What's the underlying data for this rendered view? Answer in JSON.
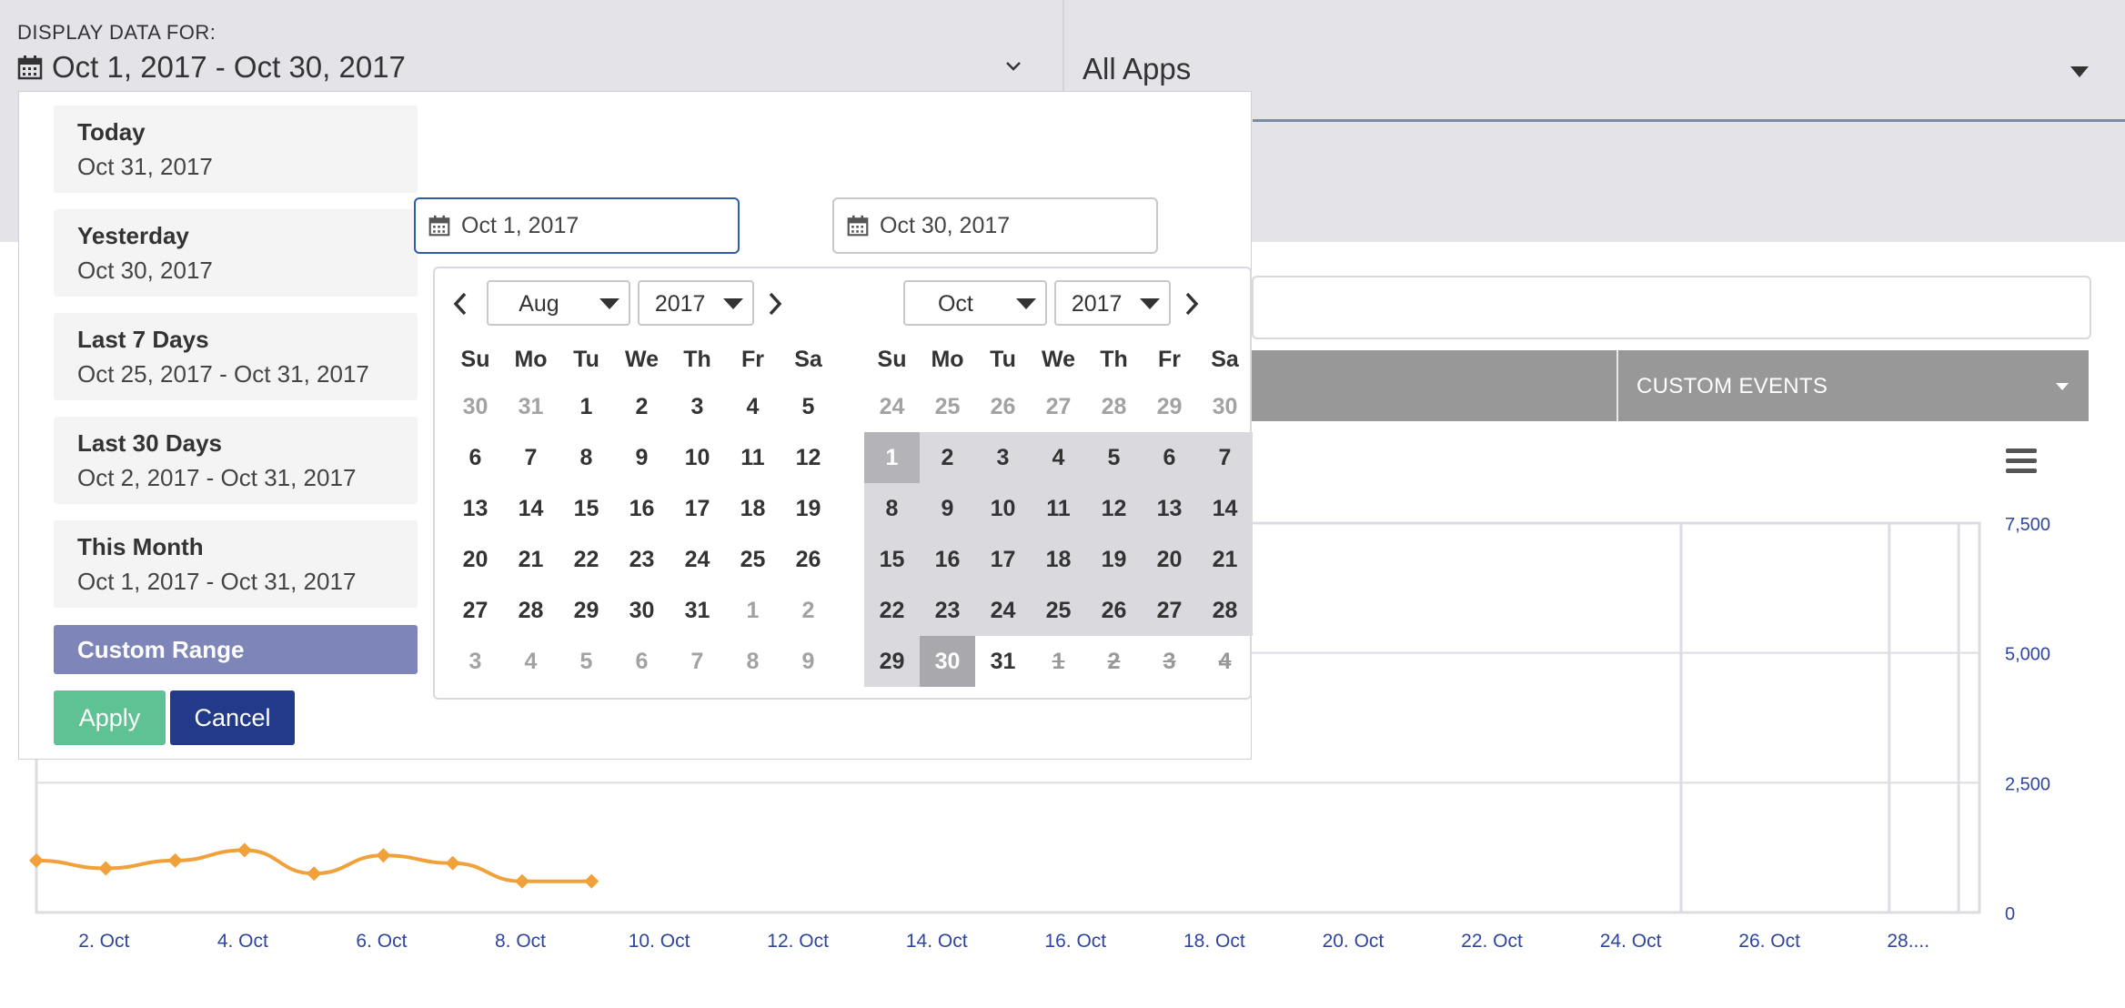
{
  "header": {
    "display_label": "DISPLAY DATA FOR:",
    "date_range": "Oct 1, 2017 - Oct 30, 2017",
    "apps_select": "All Apps"
  },
  "tabs": {
    "custom_events": "CUSTOM EVENTS"
  },
  "picker": {
    "ranges": [
      {
        "title": "Today",
        "dates": "Oct 31, 2017"
      },
      {
        "title": "Yesterday",
        "dates": "Oct 30, 2017"
      },
      {
        "title": "Last 7 Days",
        "dates": "Oct 25, 2017 - Oct 31, 2017"
      },
      {
        "title": "Last 30 Days",
        "dates": "Oct 2, 2017 - Oct 31, 2017"
      },
      {
        "title": "This Month",
        "dates": "Oct 1, 2017 - Oct 31, 2017"
      }
    ],
    "custom_range": "Custom Range",
    "apply": "Apply",
    "cancel": "Cancel",
    "start_input": "Oct 1, 2017",
    "end_input": "Oct 30, 2017",
    "weekdays": [
      "Su",
      "Mo",
      "Tu",
      "We",
      "Th",
      "Fr",
      "Sa"
    ],
    "left": {
      "month": "Aug",
      "year": "2017",
      "days": [
        "30",
        "31",
        "1",
        "2",
        "3",
        "4",
        "5",
        "6",
        "7",
        "8",
        "9",
        "10",
        "11",
        "12",
        "13",
        "14",
        "15",
        "16",
        "17",
        "18",
        "19",
        "20",
        "21",
        "22",
        "23",
        "24",
        "25",
        "26",
        "27",
        "28",
        "29",
        "30",
        "31",
        "1",
        "2",
        "3",
        "4",
        "5",
        "6",
        "7",
        "8",
        "9"
      ]
    },
    "right": {
      "month": "Oct",
      "year": "2017",
      "days": [
        "24",
        "25",
        "26",
        "27",
        "28",
        "29",
        "30",
        "1",
        "2",
        "3",
        "4",
        "5",
        "6",
        "7",
        "8",
        "9",
        "10",
        "11",
        "12",
        "13",
        "14",
        "15",
        "16",
        "17",
        "18",
        "19",
        "20",
        "21",
        "22",
        "23",
        "24",
        "25",
        "26",
        "27",
        "28",
        "29",
        "30",
        "31",
        "1",
        "2",
        "3",
        "4"
      ]
    }
  },
  "chart_data": {
    "type": "line",
    "x_tick_labels": [
      "2. Oct",
      "4. Oct",
      "6. Oct",
      "8. Oct",
      "10. Oct",
      "12. Oct",
      "14. Oct",
      "16. Oct",
      "18. Oct",
      "20. Oct",
      "22. Oct",
      "24. Oct",
      "26. Oct",
      "28...."
    ],
    "y_tick_labels": [
      "7,500",
      "5,000",
      "2,500",
      "0"
    ],
    "ylim": [
      0,
      7500
    ],
    "xlim": [
      1,
      29
    ],
    "series": [
      {
        "color": "#f0a13a",
        "x": [
          1,
          2,
          3,
          4,
          5,
          6,
          7,
          8,
          9
        ],
        "y": [
          1000,
          850,
          1000,
          1200,
          750,
          1100,
          950,
          600,
          600
        ]
      }
    ],
    "vertical_markers": [
      24.7,
      27.7,
      28.7
    ]
  }
}
